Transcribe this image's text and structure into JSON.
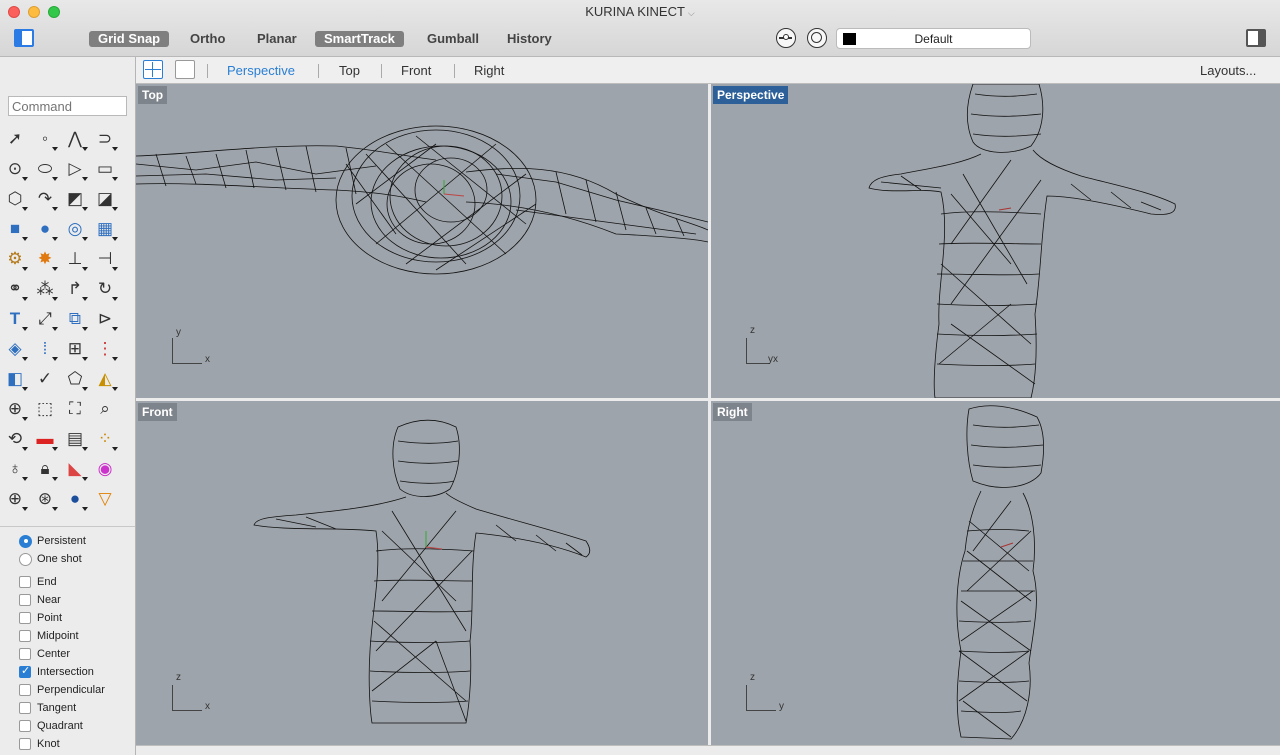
{
  "window": {
    "title": "KURINA KINECT"
  },
  "toolbar": {
    "modes": [
      {
        "label": "Grid Snap",
        "active": true
      },
      {
        "label": "Ortho",
        "active": false
      },
      {
        "label": "Planar",
        "active": false
      },
      {
        "label": "SmartTrack",
        "active": true
      },
      {
        "label": "Gumball",
        "active": false
      },
      {
        "label": "History",
        "active": false
      }
    ],
    "layer": {
      "name": "Default",
      "color": "#000000"
    }
  },
  "viewport_bar": {
    "tabs": [
      "Perspective",
      "Top",
      "Front",
      "Right"
    ],
    "active_tab": "Perspective",
    "layouts_label": "Layouts..."
  },
  "sidebar": {
    "command_placeholder": "Command",
    "osnap_mode": [
      {
        "label": "Persistent",
        "selected": true
      },
      {
        "label": "One shot",
        "selected": false
      }
    ],
    "osnaps": [
      {
        "label": "End",
        "checked": false
      },
      {
        "label": "Near",
        "checked": false
      },
      {
        "label": "Point",
        "checked": false
      },
      {
        "label": "Midpoint",
        "checked": false
      },
      {
        "label": "Center",
        "checked": false
      },
      {
        "label": "Intersection",
        "checked": true
      },
      {
        "label": "Perpendicular",
        "checked": false
      },
      {
        "label": "Tangent",
        "checked": false
      },
      {
        "label": "Quadrant",
        "checked": false
      },
      {
        "label": "Knot",
        "checked": false
      }
    ]
  },
  "viewports": {
    "top": {
      "label": "Top",
      "axis": [
        "y",
        "x"
      ]
    },
    "perspective": {
      "label": "Perspective",
      "axis": [
        "z",
        "yx"
      ]
    },
    "front": {
      "label": "Front",
      "axis": [
        "z",
        "x"
      ]
    },
    "right": {
      "label": "Right",
      "axis": [
        "z",
        "y"
      ]
    }
  },
  "colors": {
    "accent": "#2a7fd4",
    "viewport_bg": "#9ea4ab",
    "active_label": "#2d5f99"
  }
}
